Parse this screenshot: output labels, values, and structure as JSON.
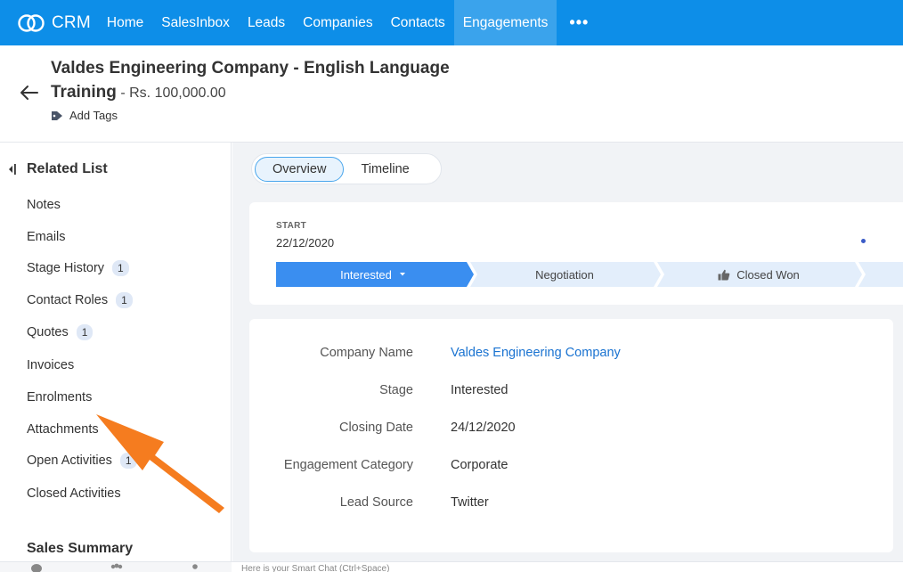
{
  "nav": {
    "logo_text": "CRM",
    "items": [
      {
        "label": "Home"
      },
      {
        "label": "SalesInbox"
      },
      {
        "label": "Leads"
      },
      {
        "label": "Companies"
      },
      {
        "label": "Contacts"
      },
      {
        "label": "Engagements"
      }
    ],
    "more_label": "•••",
    "active": "Engagements"
  },
  "header": {
    "title_line1": "Valdes Engineering Company - English Language",
    "title_line2": "Training",
    "separator": " - ",
    "amount": "Rs. 100,000.00",
    "add_tags": "Add Tags"
  },
  "sidebar": {
    "heading": "Related List",
    "items": [
      {
        "label": "Notes",
        "badge": ""
      },
      {
        "label": "Emails",
        "badge": ""
      },
      {
        "label": "Stage History",
        "badge": "1"
      },
      {
        "label": "Contact Roles",
        "badge": "1"
      },
      {
        "label": "Quotes",
        "badge": "1"
      },
      {
        "label": "Invoices",
        "badge": ""
      },
      {
        "label": "Enrolments",
        "badge": ""
      },
      {
        "label": "Attachments",
        "badge": ""
      },
      {
        "label": "Open Activities",
        "badge": "1"
      },
      {
        "label": "Closed Activities",
        "badge": ""
      }
    ],
    "sales_summary": "Sales Summary"
  },
  "tabs": [
    {
      "label": "Overview",
      "active": true
    },
    {
      "label": "Timeline",
      "active": false
    }
  ],
  "stage": {
    "start_label": "START",
    "start_date": "22/12/2020",
    "stages": [
      {
        "label": "Interested",
        "active": true
      },
      {
        "label": "Negotiation",
        "active": false
      },
      {
        "label": "Closed Won",
        "active": false
      }
    ]
  },
  "details": [
    {
      "label": "Company Name",
      "value": "Valdes Engineering Company",
      "link": true
    },
    {
      "label": "Stage",
      "value": "Interested",
      "link": false
    },
    {
      "label": "Closing Date",
      "value": "24/12/2020",
      "link": false
    },
    {
      "label": "Engagement Category",
      "value": "Corporate",
      "link": false
    },
    {
      "label": "Lead Source",
      "value": "Twitter",
      "link": false
    }
  ],
  "footer": {
    "smart_chat": "Here is your Smart Chat (Ctrl+Space)"
  },
  "colors": {
    "nav_bg": "#0d8ee8",
    "nav_active": "#3aa3ec",
    "stage_active": "#3a8ef0",
    "stage_inactive": "#e3eefb",
    "link": "#1a73d1",
    "arrow": "#f57c1f"
  }
}
